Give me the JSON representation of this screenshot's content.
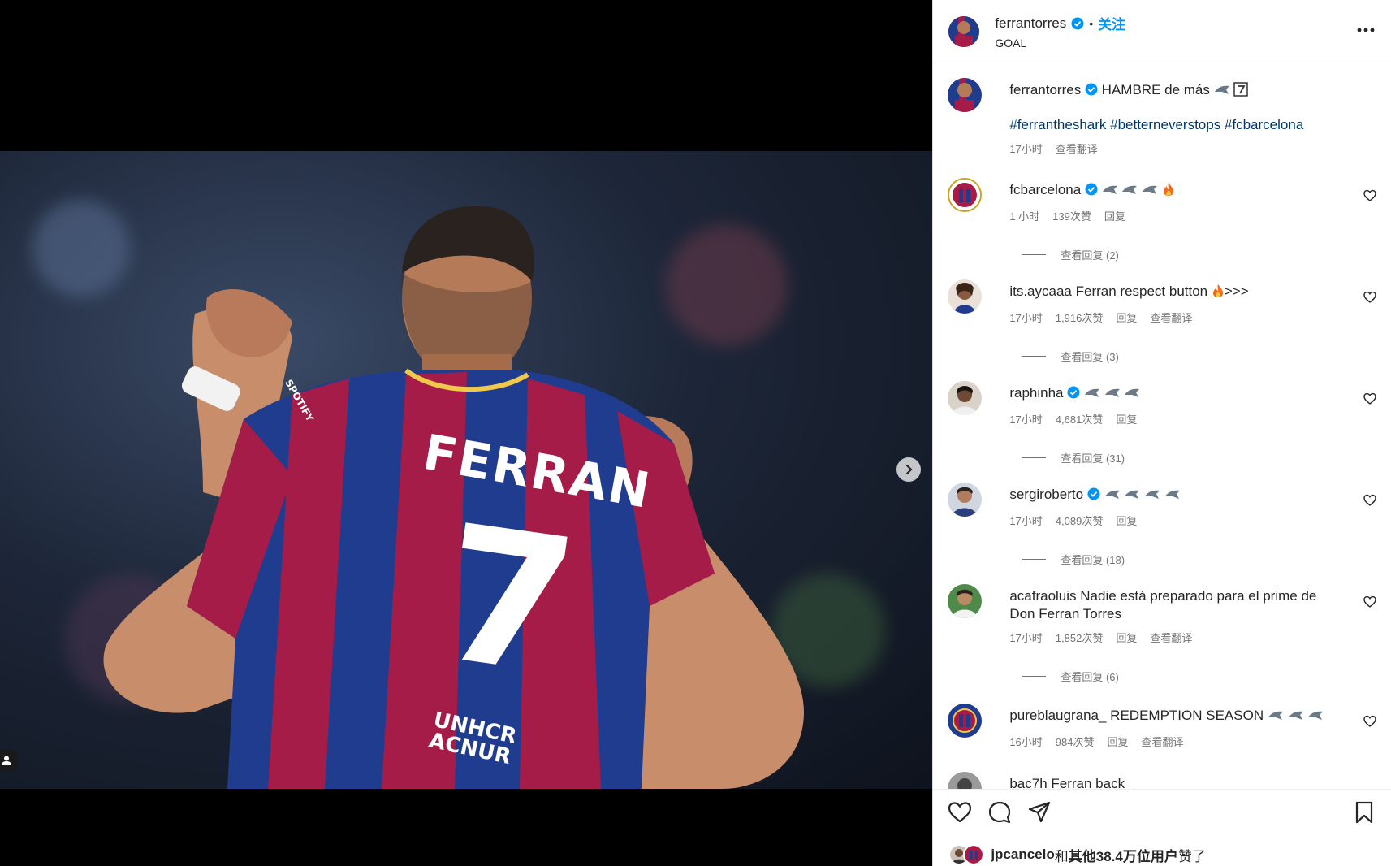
{
  "post": {
    "author": "ferrantorres",
    "follow_label": "关注",
    "dot": "•",
    "audio": "GOAL"
  },
  "caption": {
    "user": "ferrantorres",
    "text": "HAMBRE de más",
    "hashtags": "#ferrantheshark #betterneverstops #fcbarcelona",
    "time": "17小时",
    "translate": "查看翻译"
  },
  "comments": [
    {
      "user": "fcbarcelona",
      "verified": true,
      "text": "",
      "emojis": "sharks3-fire",
      "time": "1 小时",
      "likes": "139次赞",
      "reply": "回复",
      "translate": "",
      "replies": "查看回复 (2)"
    },
    {
      "user": "its.aycaaa",
      "verified": false,
      "text": "Ferran respect button",
      "suffix": ">>>",
      "time": "17小时",
      "likes": "1,916次赞",
      "reply": "回复",
      "translate": "查看翻译",
      "replies": "查看回复 (3)"
    },
    {
      "user": "raphinha",
      "verified": true,
      "text": "",
      "emojis": "sharks3",
      "time": "17小时",
      "likes": "4,681次赞",
      "reply": "回复",
      "translate": "",
      "replies": "查看回复 (31)"
    },
    {
      "user": "sergiroberto",
      "verified": true,
      "text": "",
      "emojis": "sharks4",
      "time": "17小时",
      "likes": "4,089次赞",
      "reply": "回复",
      "translate": "",
      "replies": "查看回复 (18)"
    },
    {
      "user": "acafraoluis",
      "verified": false,
      "text": "Nadie está preparado para el prime de Don Ferran Torres",
      "time": "17小时",
      "likes": "1,852次赞",
      "reply": "回复",
      "translate": "查看翻译",
      "replies": "查看回复 (6)"
    },
    {
      "user": "pureblaugrana_",
      "verified": false,
      "text": "REDEMPTION SEASON",
      "emojis": "sharks3",
      "time": "16小时",
      "likes": "984次赞",
      "reply": "回复",
      "translate": "查看翻译",
      "replies": ""
    },
    {
      "user": "bac7h",
      "verified": false,
      "text": "Ferran back",
      "time": "",
      "likes": "",
      "reply": "",
      "translate": "",
      "replies": ""
    }
  ],
  "likes_line": {
    "user": "jpcancelo",
    "middle": "和",
    "others": "其他38.4万位用户",
    "end": "赞了"
  },
  "photo": {
    "jersey_name": "FERRAN",
    "jersey_number": "7",
    "sponsor": "UNHCR ACNUR",
    "sleeve": "SPOTIFY"
  },
  "colors": {
    "accent": "#0095f6",
    "hashtag": "#00376b",
    "meta": "#737373",
    "barca_blue": "#1f3c8f",
    "barca_red": "#a51c48"
  }
}
